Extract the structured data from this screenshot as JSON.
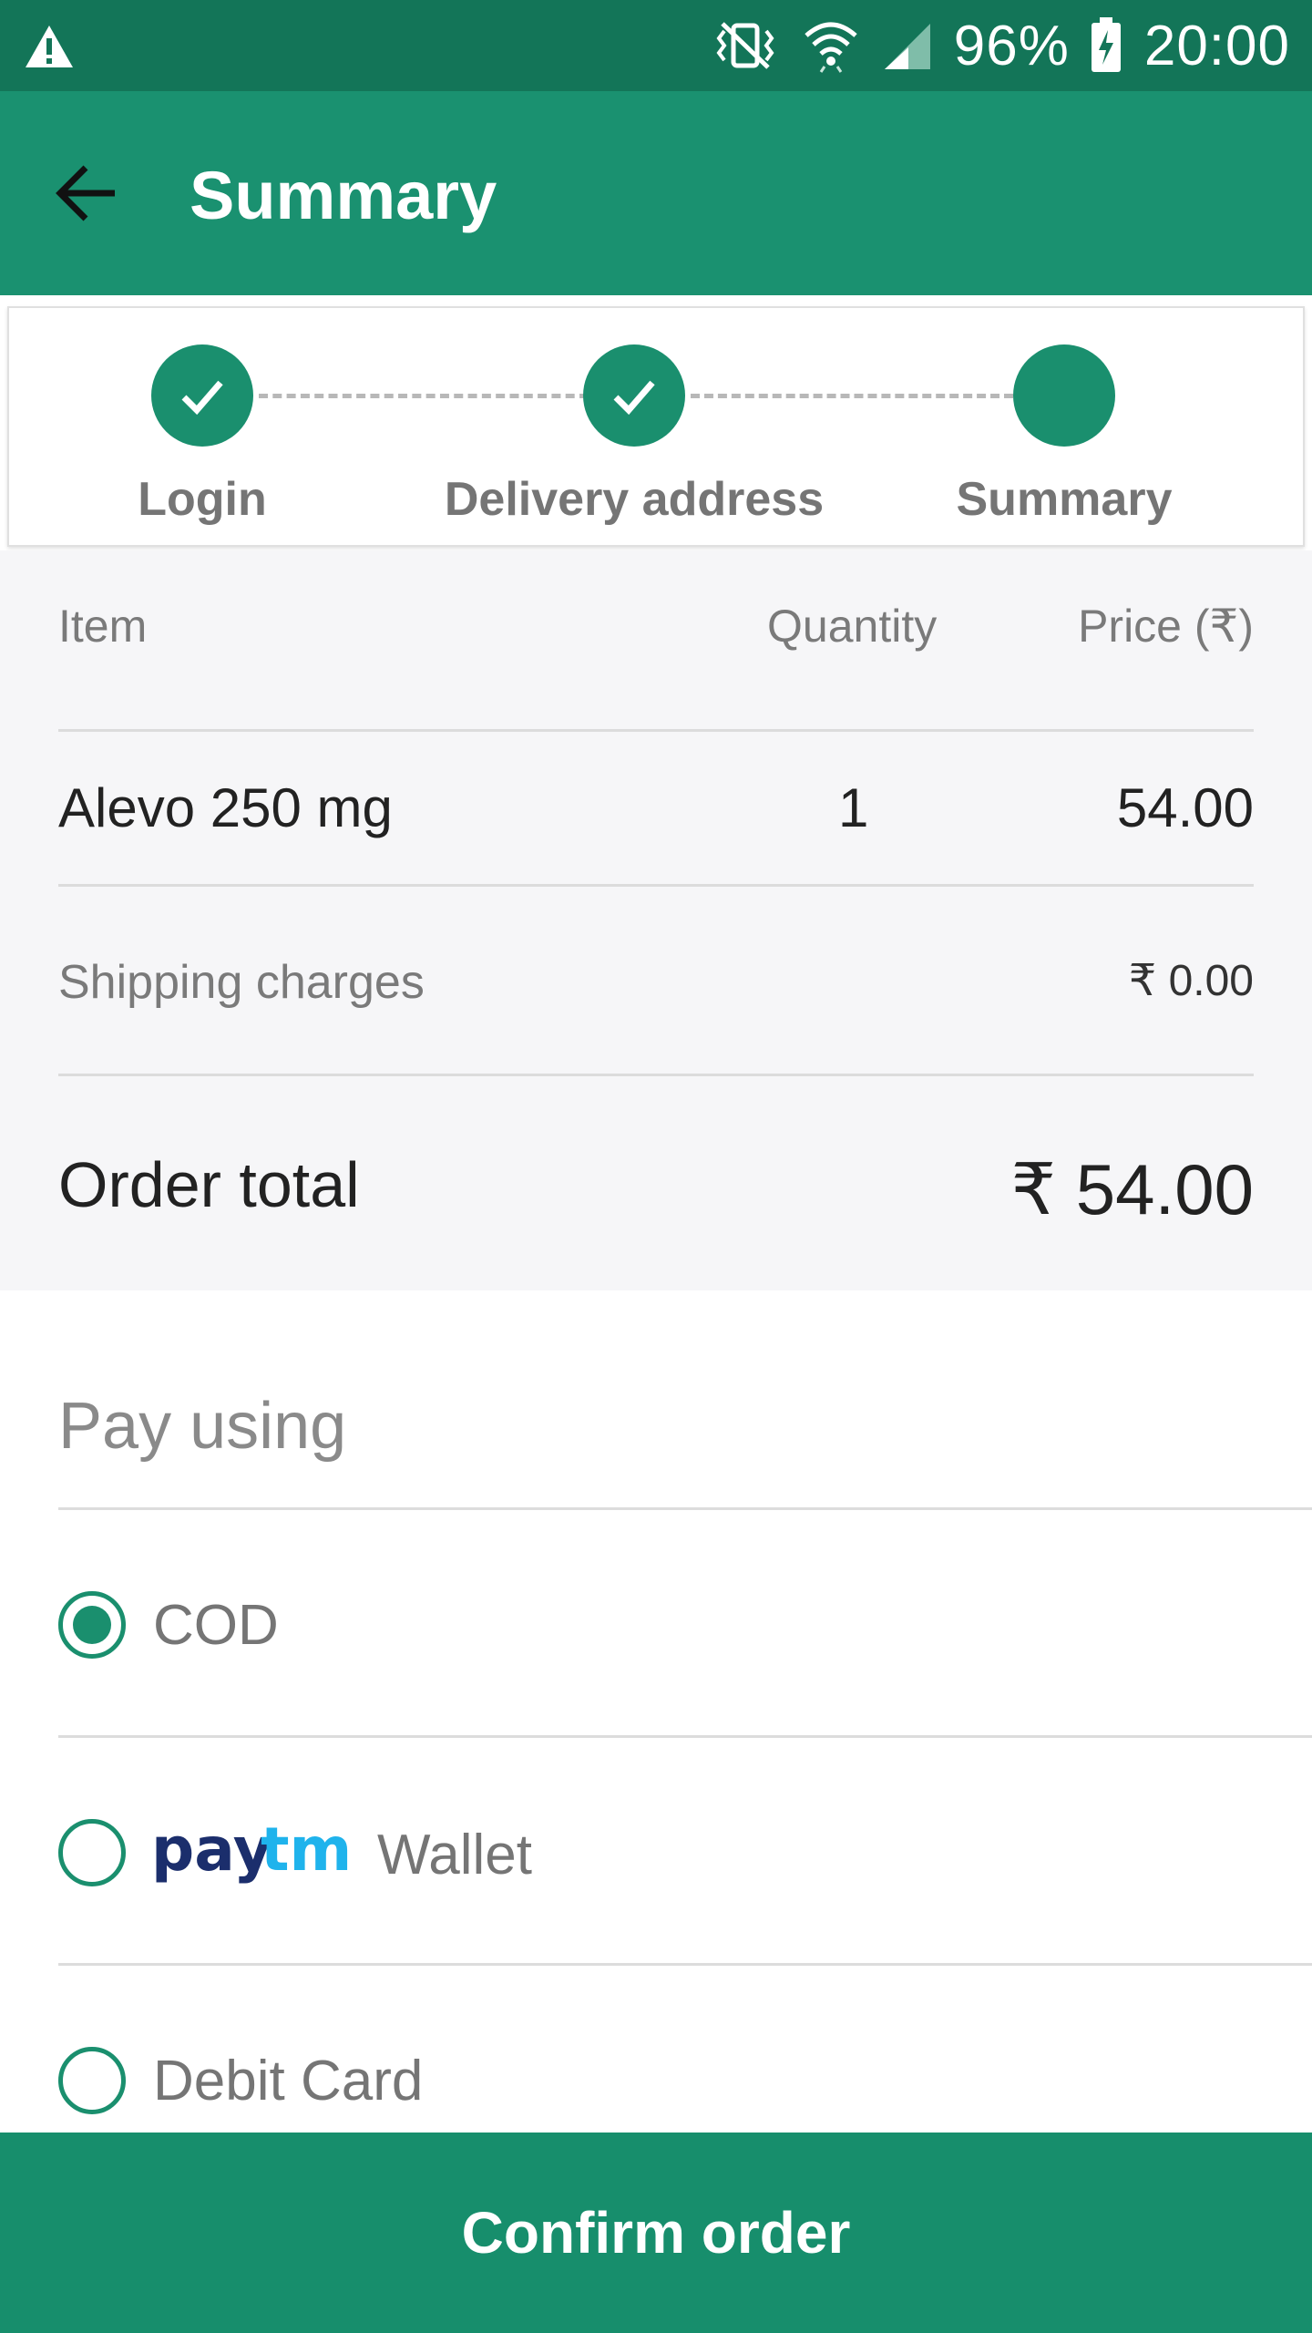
{
  "status_bar": {
    "battery": "96%",
    "time": "20:00",
    "icons": [
      "warning-icon",
      "vibrate-mute-icon",
      "wifi-icon",
      "signal-icon",
      "battery-charging-icon"
    ]
  },
  "app_bar": {
    "title": "Summary",
    "back_icon": "arrow-left-icon"
  },
  "stepper": {
    "steps": [
      {
        "label": "Login",
        "state": "done"
      },
      {
        "label": "Delivery address",
        "state": "done"
      },
      {
        "label": "Summary",
        "state": "current"
      }
    ]
  },
  "order": {
    "headers": {
      "item": "Item",
      "quantity": "Quantity",
      "price": "Price (₹)"
    },
    "items": [
      {
        "name": "Alevo 250 mg",
        "quantity": "1",
        "price": "54.00"
      }
    ],
    "shipping_label": "Shipping charges",
    "shipping_value": "₹ 0.00",
    "total_label": "Order total",
    "total_value": "₹ 54.00"
  },
  "payment": {
    "title": "Pay using",
    "options": [
      {
        "label": "COD",
        "selected": true
      },
      {
        "label": "Wallet",
        "logo": "paytm",
        "selected": false
      },
      {
        "label": "Debit Card",
        "selected": false
      }
    ]
  },
  "confirm_label": "Confirm order",
  "colors": {
    "status_bar": "#137558",
    "primary": "#1a9170",
    "accent": "#1a8f6e",
    "summary_bg": "#f6f6f8"
  }
}
